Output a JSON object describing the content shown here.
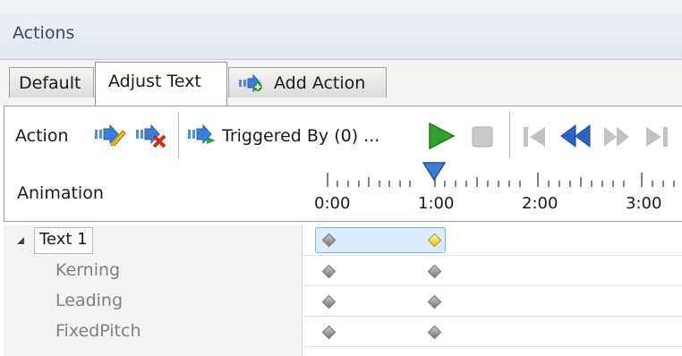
{
  "panel": {
    "title": "Actions"
  },
  "tabs": [
    {
      "label": "Default"
    },
    {
      "label": "Adjust Text"
    },
    {
      "label": "Add Action"
    }
  ],
  "toolbar": {
    "action_label": "Action",
    "triggered_label": "Triggered By (0) ...",
    "animation_label": "Animation"
  },
  "timeline": {
    "ticks": [
      "0:00",
      "1:00",
      "2:00",
      "3:00"
    ]
  },
  "tree": {
    "parent": "Text 1",
    "children": [
      "Kerning",
      "Leading",
      "FixedPitch"
    ]
  },
  "colors": {
    "accent": "#3b7dd8",
    "play": "#2fa12f",
    "selection": "#dcebfb"
  }
}
